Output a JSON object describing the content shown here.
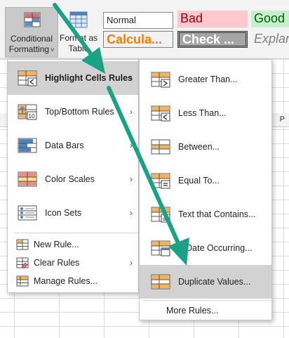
{
  "ribbon": {
    "conditional_formatting": {
      "line1": "Conditional",
      "line2": "Formatting",
      "chevron": "˅"
    },
    "format_as_table": {
      "line1": "Format as",
      "line2": "Table"
    },
    "styles": {
      "normal": "Normal",
      "bad": "Bad",
      "good": "Good",
      "calculation": "Calcula...",
      "check_cell": "Check ...",
      "explanatory": "Explan"
    }
  },
  "sheet": {
    "column_letter": "P"
  },
  "main_menu": {
    "items": [
      {
        "label": "Highlight Cells Rules",
        "icon": "highlight-cells-rules-icon",
        "has_submenu": true
      },
      {
        "label": "Top/Bottom Rules",
        "icon": "top-bottom-rules-icon",
        "has_submenu": true
      },
      {
        "label": "Data Bars",
        "icon": "data-bars-icon",
        "has_submenu": true
      },
      {
        "label": "Color Scales",
        "icon": "color-scales-icon",
        "has_submenu": true
      },
      {
        "label": "Icon Sets",
        "icon": "icon-sets-icon",
        "has_submenu": true
      }
    ],
    "small_items": [
      {
        "label": "New Rule...",
        "icon": "new-rule-icon",
        "has_submenu": false
      },
      {
        "label": "Clear Rules",
        "icon": "clear-rules-icon",
        "has_submenu": true
      },
      {
        "label": "Manage Rules...",
        "icon": "manage-rules-icon",
        "has_submenu": false
      }
    ],
    "submenu_arrow": "›"
  },
  "sub_menu": {
    "items": [
      {
        "label": "Greater Than...",
        "icon": "greater-than-icon"
      },
      {
        "label": "Less Than...",
        "icon": "less-than-icon"
      },
      {
        "label": "Between...",
        "icon": "between-icon"
      },
      {
        "label": "Equal To...",
        "icon": "equal-to-icon"
      },
      {
        "label": "Text that Contains...",
        "icon": "text-contains-icon"
      },
      {
        "label": "A Date Occurring...",
        "icon": "date-occurring-icon"
      },
      {
        "label": "Duplicate Values...",
        "icon": "duplicate-values-icon"
      }
    ],
    "more_rules": "More Rules..."
  },
  "colors": {
    "highlight": "#d2d2d2",
    "annotation_arrow": "#1aa382",
    "icon_blue": "#4f81bd",
    "icon_orange": "#f5b35a"
  }
}
